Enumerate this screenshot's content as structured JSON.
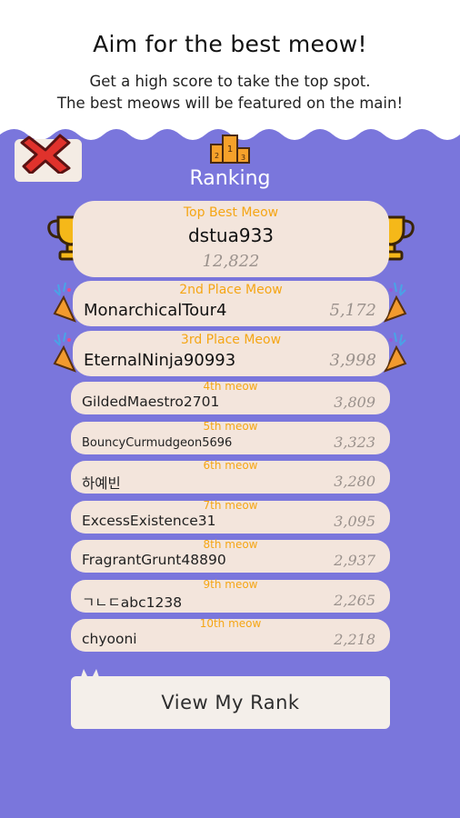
{
  "header": {
    "title": "Aim for the best meow!",
    "subtitle_line1": "Get a high score to take the top spot.",
    "subtitle_line2": "The best meows will be featured on the main!"
  },
  "ranking": {
    "title": "Ranking",
    "top": {
      "place": "Top Best Meow",
      "name": "dstua933",
      "score": "12,822"
    },
    "second": {
      "place": "2nd Place Meow",
      "name": "MonarchicalTour4",
      "score": "5,172"
    },
    "third": {
      "place": "3rd Place Meow",
      "name": "EternalNinja90993",
      "score": "3,998"
    },
    "rows": [
      {
        "place": "4th meow",
        "name": "GildedMaestro2701",
        "score": "3,809"
      },
      {
        "place": "5th meow",
        "name": "BouncyCurmudgeon5696",
        "score": "3,323"
      },
      {
        "place": "6th meow",
        "name": "하예빈",
        "score": "3,280"
      },
      {
        "place": "7th meow",
        "name": "ExcessExistence31",
        "score": "3,095"
      },
      {
        "place": "8th meow",
        "name": "FragrantGrunt48890",
        "score": "2,937"
      },
      {
        "place": "9th meow",
        "name": "ㄱㄴㄷabc1238",
        "score": "2,265"
      },
      {
        "place": "10th meow",
        "name": "chyooni",
        "score": "2,218"
      }
    ]
  },
  "actions": {
    "view_my_rank": "View My Rank"
  },
  "icons": {
    "close": "close-x-icon",
    "podium": "podium-icon",
    "trophy": "trophy-icon",
    "party": "party-popper-icon"
  },
  "colors": {
    "background": "#7a76dc",
    "card": "#f3e5dc",
    "accent_orange": "#f5a615",
    "close_red": "#e0322c"
  }
}
